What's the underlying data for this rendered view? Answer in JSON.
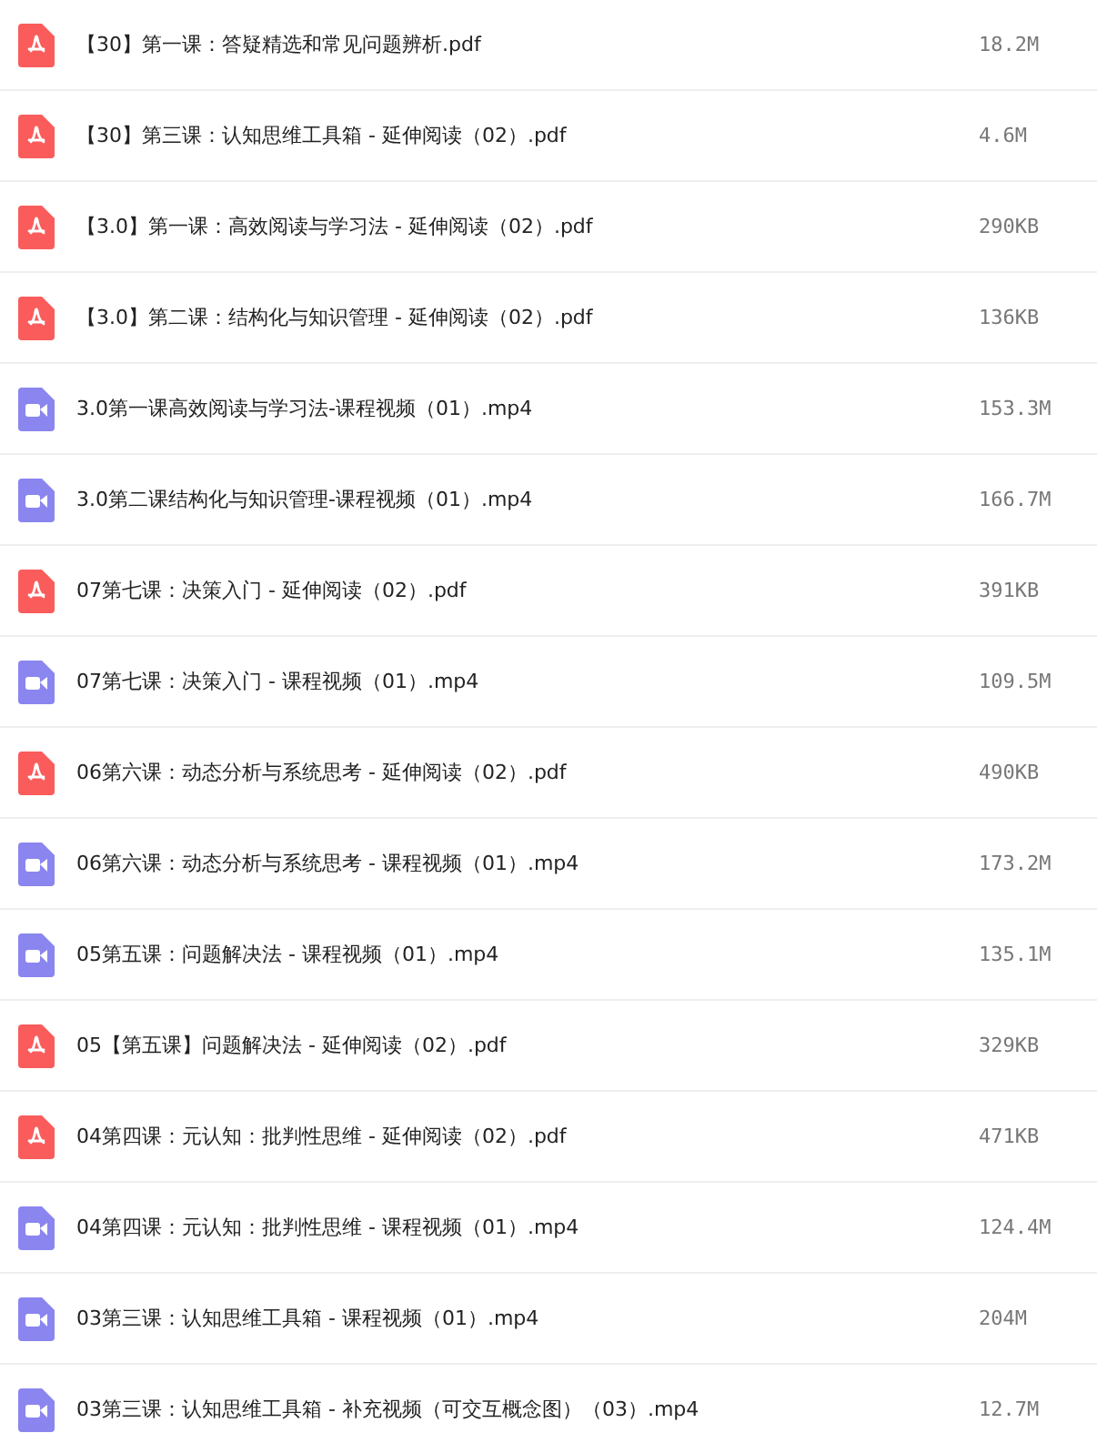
{
  "files": [
    {
      "kind": "pdf",
      "name": "【30】第一课：答疑精选和常见问题辨析.pdf",
      "size": "18.2M"
    },
    {
      "kind": "pdf",
      "name": "【30】第三课：认知思维工具箱 - 延伸阅读（02）.pdf",
      "size": "4.6M"
    },
    {
      "kind": "pdf",
      "name": "【3.0】第一课：高效阅读与学习法 - 延伸阅读（02）.pdf",
      "size": "290KB"
    },
    {
      "kind": "pdf",
      "name": "【3.0】第二课：结构化与知识管理 - 延伸阅读（02）.pdf",
      "size": "136KB"
    },
    {
      "kind": "video",
      "name": "3.0第一课高效阅读与学习法-课程视频（01）.mp4",
      "size": "153.3M"
    },
    {
      "kind": "video",
      "name": "3.0第二课结构化与知识管理-课程视频（01）.mp4",
      "size": "166.7M"
    },
    {
      "kind": "pdf",
      "name": "07第七课：决策入门 - 延伸阅读（02）.pdf",
      "size": "391KB"
    },
    {
      "kind": "video",
      "name": "07第七课：决策入门 - 课程视频（01）.mp4",
      "size": "109.5M"
    },
    {
      "kind": "pdf",
      "name": "06第六课：动态分析与系统思考 - 延伸阅读（02）.pdf",
      "size": "490KB"
    },
    {
      "kind": "video",
      "name": "06第六课：动态分析与系统思考 - 课程视频（01）.mp4",
      "size": "173.2M"
    },
    {
      "kind": "video",
      "name": "05第五课：问题解决法 - 课程视频（01）.mp4",
      "size": "135.1M"
    },
    {
      "kind": "pdf",
      "name": "05【第五课】问题解决法 - 延伸阅读（02）.pdf",
      "size": "329KB"
    },
    {
      "kind": "pdf",
      "name": "04第四课：元认知：批判性思维 - 延伸阅读（02）.pdf",
      "size": "471KB"
    },
    {
      "kind": "video",
      "name": "04第四课：元认知：批判性思维 - 课程视频（01）.mp4",
      "size": "124.4M"
    },
    {
      "kind": "video",
      "name": "03第三课：认知思维工具箱 - 课程视频（01）.mp4",
      "size": "204M"
    },
    {
      "kind": "video",
      "name": "03第三课：认知思维工具箱 - 补充视频（可交互概念图）（03）.mp4",
      "size": "12.7M"
    }
  ]
}
